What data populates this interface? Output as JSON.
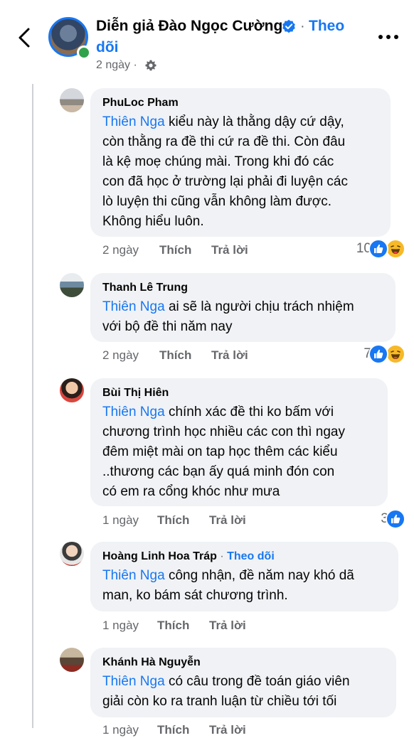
{
  "post_header": {
    "name": "Diễn giả Đào Ngọc Cường",
    "separator": "·",
    "follow_line1": "Theo",
    "follow_line2": "dõi",
    "time": "2 ngày ·",
    "icons": {
      "back": "chevron-left-icon",
      "verified": "verified-badge-icon",
      "audience": "gear-icon",
      "more": "more-horizontal-icon"
    }
  },
  "colors": {
    "accent": "#1877f2",
    "bubble": "#f0f2f5",
    "secondary_text": "#65676b",
    "online": "#31a24c"
  },
  "comments": [
    {
      "author": "PhuLoc Pham",
      "mention": "Thiên Nga",
      "lines": [
        " kiểu này là thằng dậy cứ dậy,",
        "còn thằng ra đề thi cứ ra đề thi. Còn đâu",
        "là kệ moẹ chúng mài. Trong khi đó các",
        "con đã học ở trường lại phải đi luyện các",
        "lò luyện thi cũng vẫn không làm được.",
        "Không hiểu luôn."
      ],
      "time": "2 ngày",
      "like": "Thích",
      "reply": "Trả lời",
      "reactions": {
        "count": "10",
        "types": [
          "like",
          "haha"
        ]
      }
    },
    {
      "author": "Thanh Lê Trung",
      "mention": "Thiên Nga",
      "lines": [
        " ai sẽ là người chịu trách nhiệm",
        "với bộ đề thi năm nay"
      ],
      "time": "2 ngày",
      "like": "Thích",
      "reply": "Trả lời",
      "reactions": {
        "count": "7",
        "types": [
          "like",
          "haha"
        ]
      }
    },
    {
      "author": "Bùi Thị Hiên",
      "mention": "Thiên Nga",
      "lines": [
        " chính xác đề thi ko bấm với",
        "chương trình học nhiều các con thì ngay",
        "đêm miệt mài  on tap học thêm các kiểu",
        "..thương các bạn ấy quá  minh đón con",
        "có em ra cổng khóc như mưa"
      ],
      "time": "1 ngày",
      "like": "Thích",
      "reply": "Trả lời",
      "reactions": {
        "count": "3",
        "types": [
          "like"
        ]
      }
    },
    {
      "author": "Hoàng Linh Hoa Tráp",
      "author_sep": " · ",
      "author_follow": "Theo dõi",
      "mention": "Thiên Nga",
      "lines": [
        " công nhận, đề năm nay khó dã",
        "man, ko bám sát chương trình."
      ],
      "time": "1 ngày",
      "like": "Thích",
      "reply": "Trả lời"
    },
    {
      "author": "Khánh Hà Nguyễn",
      "mention": "Thiên Nga",
      "lines": [
        " có câu trong đề toán giáo viên",
        "giải còn ko ra tranh luận từ chiều tới tối"
      ],
      "time": "1 ngày",
      "like": "Thích",
      "reply": "Trả lời"
    }
  ]
}
